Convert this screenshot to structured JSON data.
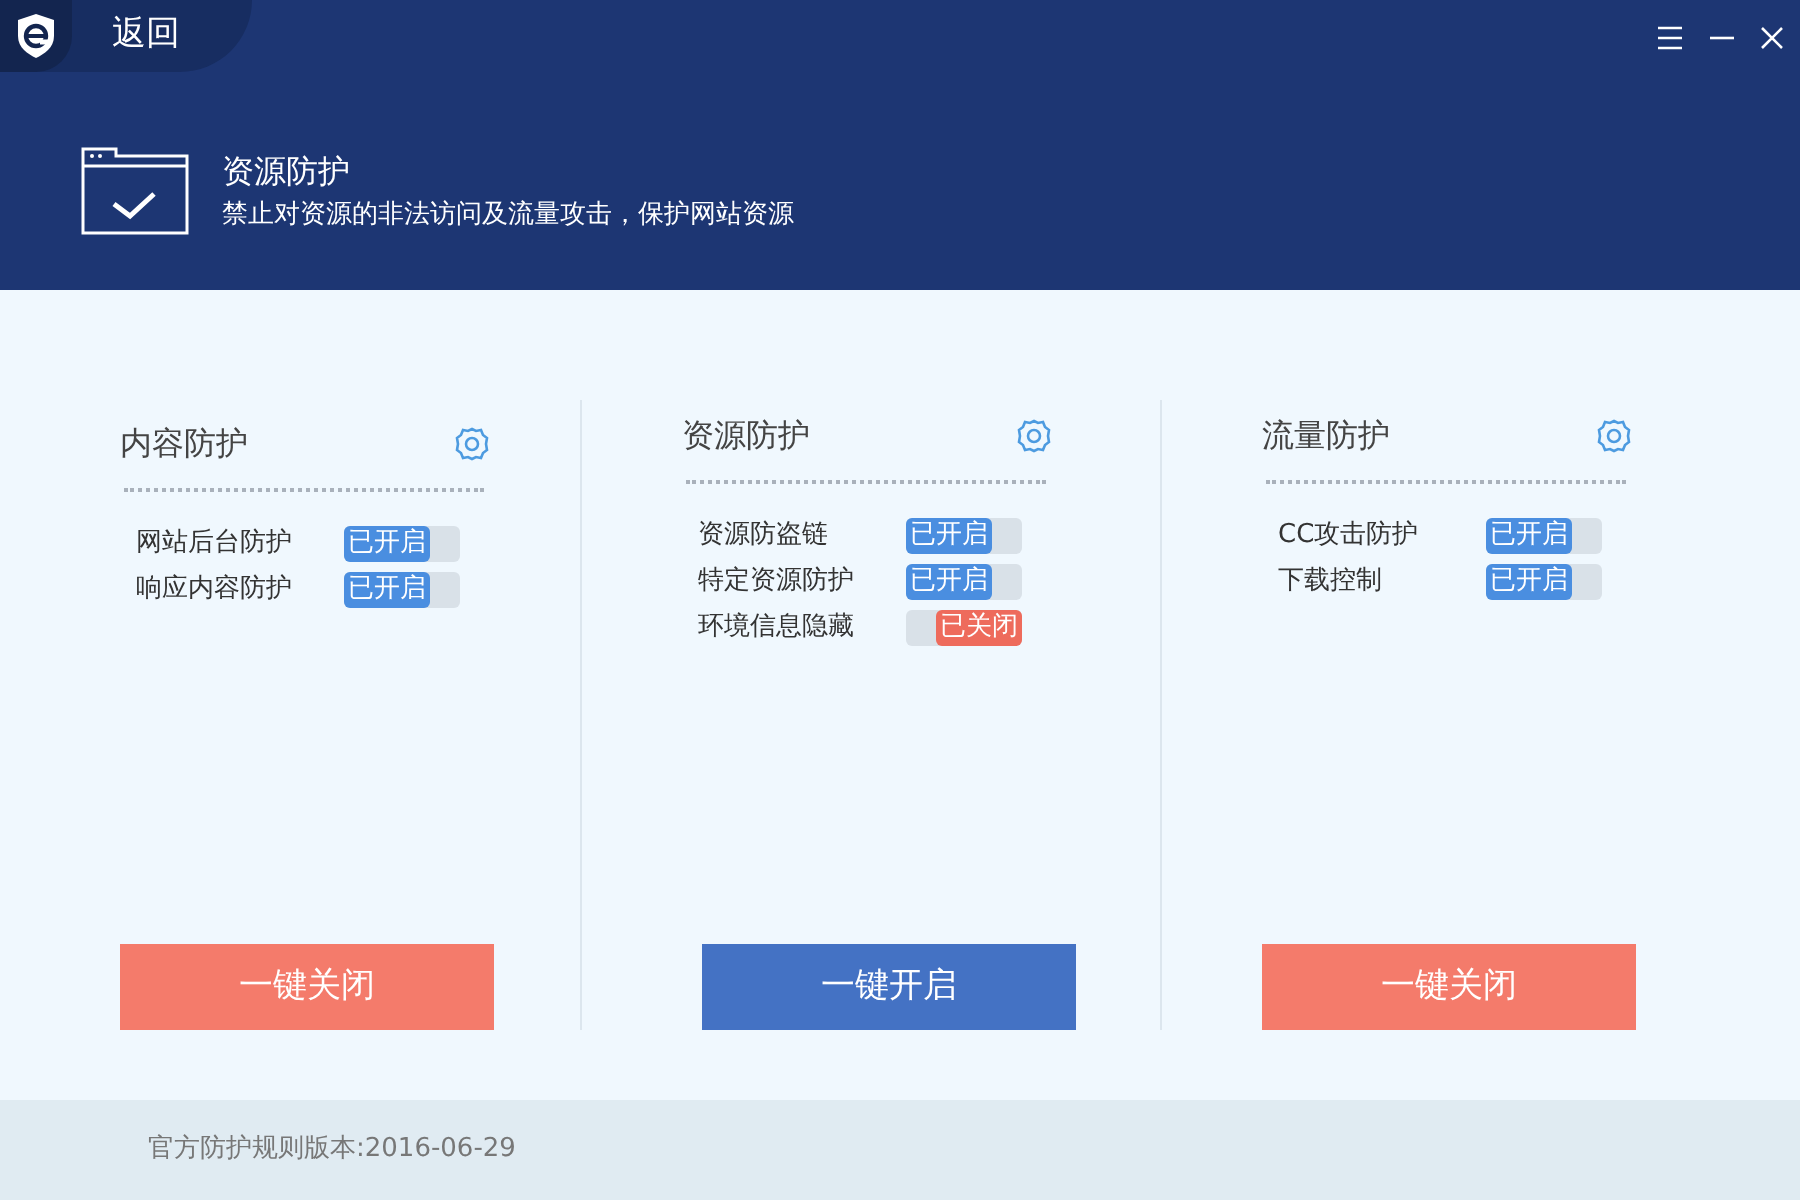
{
  "titlebar": {
    "back_label": "返回"
  },
  "banner": {
    "title": "资源防护",
    "subtitle": "禁止对资源的非法访问及流量攻击，保护网站资源"
  },
  "panels": [
    {
      "title": "内容防护",
      "items": [
        {
          "label": "网站后台防护",
          "on": true,
          "status": "已开启"
        },
        {
          "label": "响应内容防护",
          "on": true,
          "status": "已开启"
        }
      ],
      "button": {
        "label": "一键关闭",
        "kind": "close"
      }
    },
    {
      "title": "资源防护",
      "items": [
        {
          "label": "资源防盗链",
          "on": true,
          "status": "已开启"
        },
        {
          "label": "特定资源防护",
          "on": true,
          "status": "已开启"
        },
        {
          "label": "环境信息隐藏",
          "on": false,
          "status": "已关闭"
        }
      ],
      "button": {
        "label": "一键开启",
        "kind": "open"
      }
    },
    {
      "title": "流量防护",
      "items": [
        {
          "label": "CC攻击防护",
          "on": true,
          "status": "已开启"
        },
        {
          "label": "下载控制",
          "on": true,
          "status": "已开启"
        }
      ],
      "button": {
        "label": "一键关闭",
        "kind": "close"
      }
    }
  ],
  "footer": {
    "version_text": "官方防护规则版本:2016-06-29"
  }
}
